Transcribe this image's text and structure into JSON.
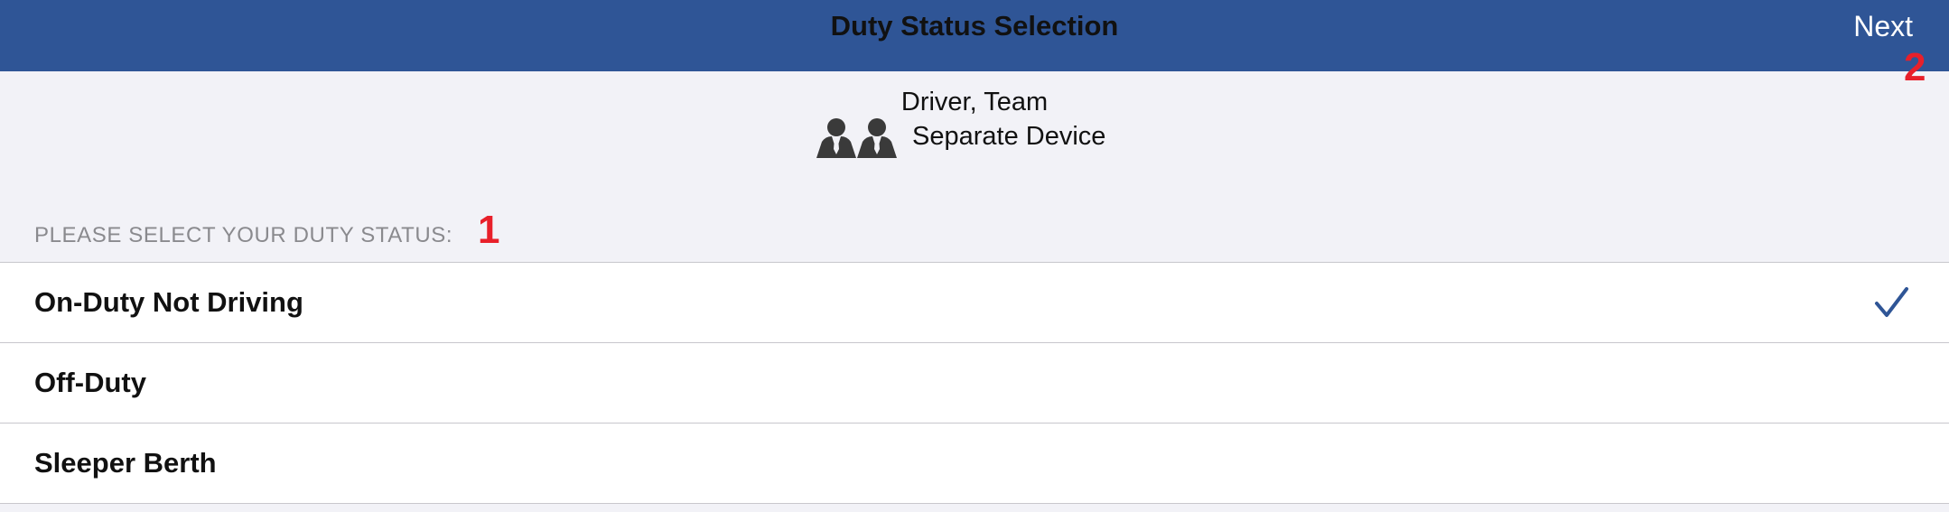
{
  "header": {
    "title": "Duty Status Selection",
    "next_label": "Next",
    "background_color": "#2f5596"
  },
  "annotations": {
    "marker_1": "1",
    "marker_2": "2",
    "color": "#e8202a"
  },
  "driver": {
    "role": "Driver, Team",
    "device": "Separate Device",
    "icon": "team-people-icon"
  },
  "section": {
    "header": "PLEASE SELECT YOUR DUTY STATUS:"
  },
  "statuses": [
    {
      "label": "On-Duty Not Driving",
      "selected": true
    },
    {
      "label": "Off-Duty",
      "selected": false
    },
    {
      "label": "Sleeper Berth",
      "selected": false
    }
  ],
  "accent_color": "#2f5596"
}
